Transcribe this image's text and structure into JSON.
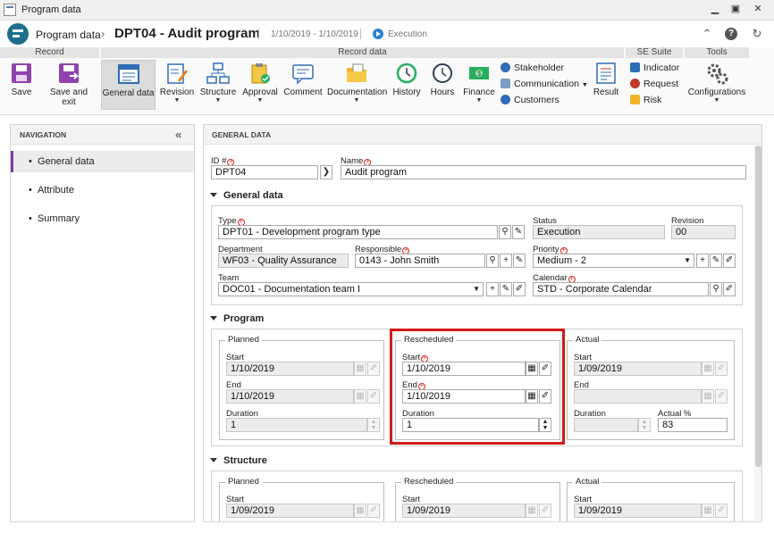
{
  "window": {
    "title": "Program data"
  },
  "header": {
    "app": "Program data",
    "title": "DPT04 - Audit program",
    "dates": "1/10/2019 - 1/10/2019",
    "status": "Execution"
  },
  "ribbon": {
    "groups": [
      "Record",
      "Record data",
      "SE Suite",
      "Tools"
    ],
    "buttons": [
      {
        "label": "Save",
        "icon": "save-icon"
      },
      {
        "label": "Save and exit",
        "icon": "save-exit-icon"
      },
      {
        "label": "General data",
        "icon": "general-data-icon"
      },
      {
        "label": "Revision",
        "icon": "revision-icon"
      },
      {
        "label": "Structure",
        "icon": "structure-icon"
      },
      {
        "label": "Approval",
        "icon": "approval-icon"
      },
      {
        "label": "Comment",
        "icon": "comment-icon"
      },
      {
        "label": "Documentation",
        "icon": "documentation-icon"
      },
      {
        "label": "History",
        "icon": "history-icon"
      },
      {
        "label": "Hours",
        "icon": "hours-icon"
      },
      {
        "label": "Finance",
        "icon": "finance-icon"
      },
      {
        "label": "Result",
        "icon": "result-icon"
      },
      {
        "label": "Configurations",
        "icon": "configurations-icon"
      }
    ],
    "small": {
      "stakeholder": "Stakeholder",
      "communication": "Communication",
      "customers": "Customers",
      "indicator": "Indicator",
      "request": "Request",
      "risk": "Risk"
    }
  },
  "nav": {
    "title": "NAVIGATION",
    "items": [
      "General data",
      "Attribute",
      "Summary"
    ]
  },
  "main": {
    "title": "GENERAL DATA",
    "id_label": "ID #",
    "id_value": "DPT04",
    "name_label": "Name",
    "name_value": "Audit program",
    "general": {
      "title": "General data",
      "type_label": "Type",
      "type_value": "DPT01 - Development program type",
      "status_label": "Status",
      "status_value": "Execution",
      "revision_label": "Revision",
      "revision_value": "00",
      "department_label": "Department",
      "department_value": "WF03 - Quality Assurance",
      "responsible_label": "Responsible",
      "responsible_value": "0143 - John Smith",
      "priority_label": "Priority",
      "priority_value": "Medium - 2",
      "team_label": "Team",
      "team_value": "DOC01 - Documentation team I",
      "calendar_label": "Calendar",
      "calendar_value": "STD - Corporate Calendar"
    },
    "program": {
      "title": "Program",
      "planned": {
        "legend": "Planned",
        "start_label": "Start",
        "start": "1/10/2019",
        "end_label": "End",
        "end": "1/10/2019",
        "duration_label": "Duration",
        "duration": "1"
      },
      "rescheduled": {
        "legend": "Rescheduled",
        "start_label": "Start",
        "start": "1/10/2019",
        "end_label": "End",
        "end": "1/10/2019",
        "duration_label": "Duration",
        "duration": "1"
      },
      "actual": {
        "legend": "Actual",
        "start_label": "Start",
        "start": "1/09/2019",
        "end_label": "End",
        "end": "",
        "duration_label": "Duration",
        "duration": "",
        "actual_pct_label": "Actual %",
        "actual_pct": "83"
      }
    },
    "structure": {
      "title": "Structure",
      "planned": {
        "legend": "Planned",
        "start_label": "Start",
        "start": "1/09/2019"
      },
      "rescheduled": {
        "legend": "Rescheduled",
        "start_label": "Start",
        "start": "1/09/2019"
      },
      "actual": {
        "legend": "Actual",
        "start_label": "Start",
        "start": "1/09/2019"
      }
    }
  },
  "colors": {
    "accent": "#7a3e9d",
    "highlight": "#d21a1a",
    "status": "#2a7fd4"
  }
}
